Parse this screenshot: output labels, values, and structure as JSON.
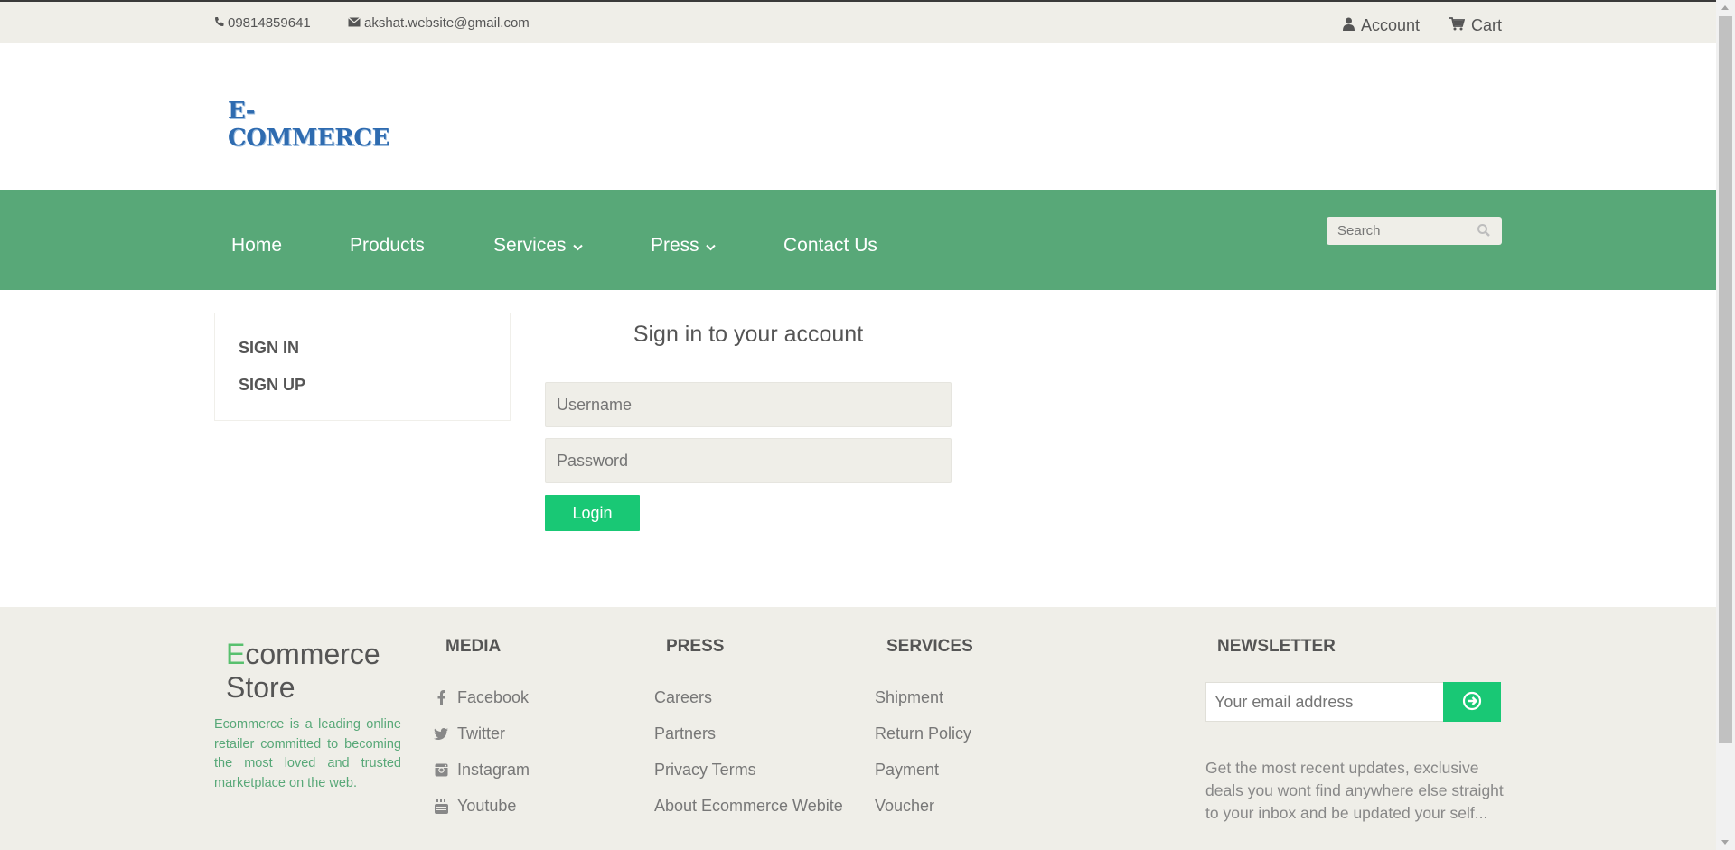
{
  "topbar": {
    "phone": "09814859641",
    "email": "akshat.website@gmail.com",
    "account_label": "Account",
    "cart_label": "Cart"
  },
  "header": {
    "logo_text": "E-COMMERCE"
  },
  "nav": {
    "items": [
      {
        "label": "Home"
      },
      {
        "label": "Products"
      },
      {
        "label": "Services"
      },
      {
        "label": "Press"
      },
      {
        "label": "Contact Us"
      }
    ],
    "search_placeholder": "Search"
  },
  "sidebar": {
    "sign_in": "SIGN IN",
    "sign_up": "SIGN UP"
  },
  "login": {
    "title": "Sign in to your account",
    "username_placeholder": "Username",
    "password_placeholder": "Password",
    "button_label": "Login"
  },
  "footer": {
    "brand_first": "E",
    "brand_rest_line1": "commerce",
    "brand_line2": "Store",
    "about": "Ecommerce is a leading online retailer committed to becoming the most loved and trusted marketplace on the web.",
    "media": {
      "heading": "MEDIA",
      "links": [
        "Facebook",
        "Twitter",
        "Instagram",
        "Youtube"
      ]
    },
    "press": {
      "heading": "PRESS",
      "links": [
        "Careers",
        "Partners",
        "Privacy Terms",
        "About Ecommerce Webite"
      ]
    },
    "services": {
      "heading": "SERVICES",
      "links": [
        "Shipment",
        "Return Policy",
        "Payment",
        "Voucher"
      ]
    },
    "newsletter": {
      "heading": "NEWSLETTER",
      "placeholder": "Your email address",
      "text": "Get the most recent updates, exclusive deals you wont find anywhere else straight to your inbox and be updated your self..."
    }
  },
  "colors": {
    "nav_green": "#58a878",
    "accent_green": "#19c875",
    "topbar_bg": "#efeee8"
  }
}
